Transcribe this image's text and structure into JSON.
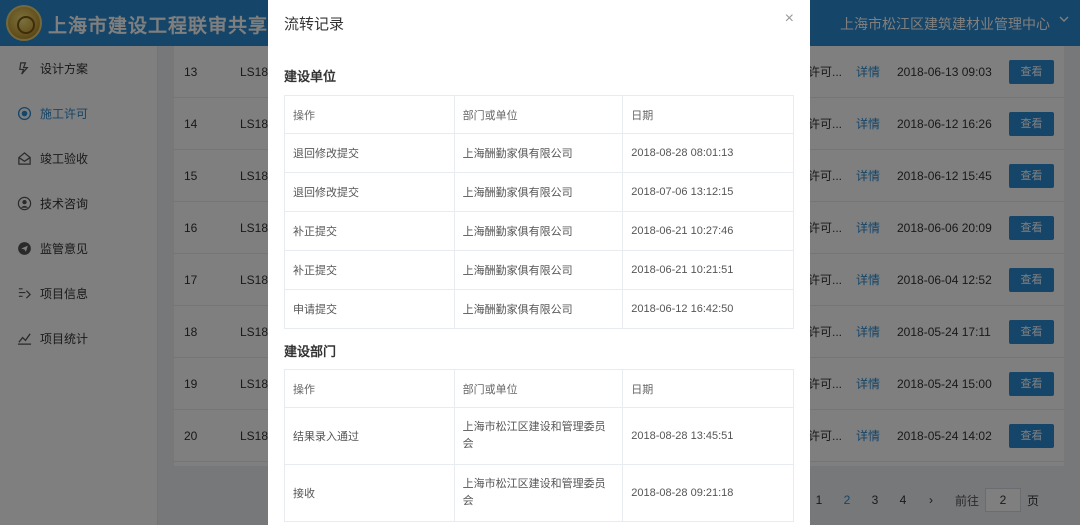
{
  "header": {
    "title": "上海市建设工程联审共享平台",
    "org": "上海市松江区建筑建材业管理中心"
  },
  "sidebar": {
    "items": [
      {
        "label": "设计方案",
        "icon": "design-plan-icon"
      },
      {
        "label": "施工许可",
        "icon": "target-icon",
        "active": true
      },
      {
        "label": "竣工验收",
        "icon": "mail-icon"
      },
      {
        "label": "技术咨询",
        "icon": "user-circle-icon"
      },
      {
        "label": "监管意见",
        "icon": "send-icon"
      },
      {
        "label": "项目信息",
        "icon": "project-info-icon"
      },
      {
        "label": "项目统计",
        "icon": "line-chart-icon"
      }
    ]
  },
  "table": {
    "rows": [
      {
        "no": "13",
        "code": "LS18",
        "status": "许可...",
        "link": "详情",
        "date": "2018-06-13 09:03",
        "btn": "查看"
      },
      {
        "no": "14",
        "code": "LS18",
        "status": "许可...",
        "link": "详情",
        "date": "2018-06-12 16:26",
        "btn": "查看"
      },
      {
        "no": "15",
        "code": "LS18",
        "status": "许可...",
        "link": "详情",
        "date": "2018-06-12 15:45",
        "btn": "查看"
      },
      {
        "no": "16",
        "code": "LS18",
        "status": "许可...",
        "link": "详情",
        "date": "2018-06-06 20:09",
        "btn": "查看"
      },
      {
        "no": "17",
        "code": "LS18",
        "status": "许可...",
        "link": "详情",
        "date": "2018-06-04 12:52",
        "btn": "查看"
      },
      {
        "no": "18",
        "code": "LS18",
        "status": "许可...",
        "link": "详情",
        "date": "2018-05-24 17:11",
        "btn": "查看"
      },
      {
        "no": "19",
        "code": "LS18",
        "status": "许可...",
        "link": "详情",
        "date": "2018-05-24 15:00",
        "btn": "查看"
      },
      {
        "no": "20",
        "code": "LS18",
        "status": "许可...",
        "link": "详情",
        "date": "2018-05-24 14:02",
        "btn": "查看"
      }
    ]
  },
  "pager": {
    "pages": [
      "1",
      "2",
      "3",
      "4"
    ],
    "current": "2",
    "next": "›",
    "goto_label": "前往",
    "goto_value": "2",
    "page_unit": "页"
  },
  "modal": {
    "title": "流转记录",
    "close": "×",
    "sections": [
      {
        "title": "建设单位",
        "headers": [
          "操作",
          "部门或单位",
          "日期"
        ],
        "rows": [
          [
            "退回修改提交",
            "上海酬勤家俱有限公司",
            "2018-08-28 08:01:13"
          ],
          [
            "退回修改提交",
            "上海酬勤家俱有限公司",
            "2018-07-06 13:12:15"
          ],
          [
            "补正提交",
            "上海酬勤家俱有限公司",
            "2018-06-21 10:27:46"
          ],
          [
            "补正提交",
            "上海酬勤家俱有限公司",
            "2018-06-21 10:21:51"
          ],
          [
            "申请提交",
            "上海酬勤家俱有限公司",
            "2018-06-12 16:42:50"
          ]
        ]
      },
      {
        "title": "建设部门",
        "headers": [
          "操作",
          "部门或单位",
          "日期"
        ],
        "rows": [
          [
            "结果录入通过",
            "上海市松江区建设和管理委员会",
            "2018-08-28 13:45:51"
          ],
          [
            "接收",
            "上海市松江区建设和管理委员会",
            "2018-08-28 09:21:18"
          ]
        ]
      }
    ]
  }
}
